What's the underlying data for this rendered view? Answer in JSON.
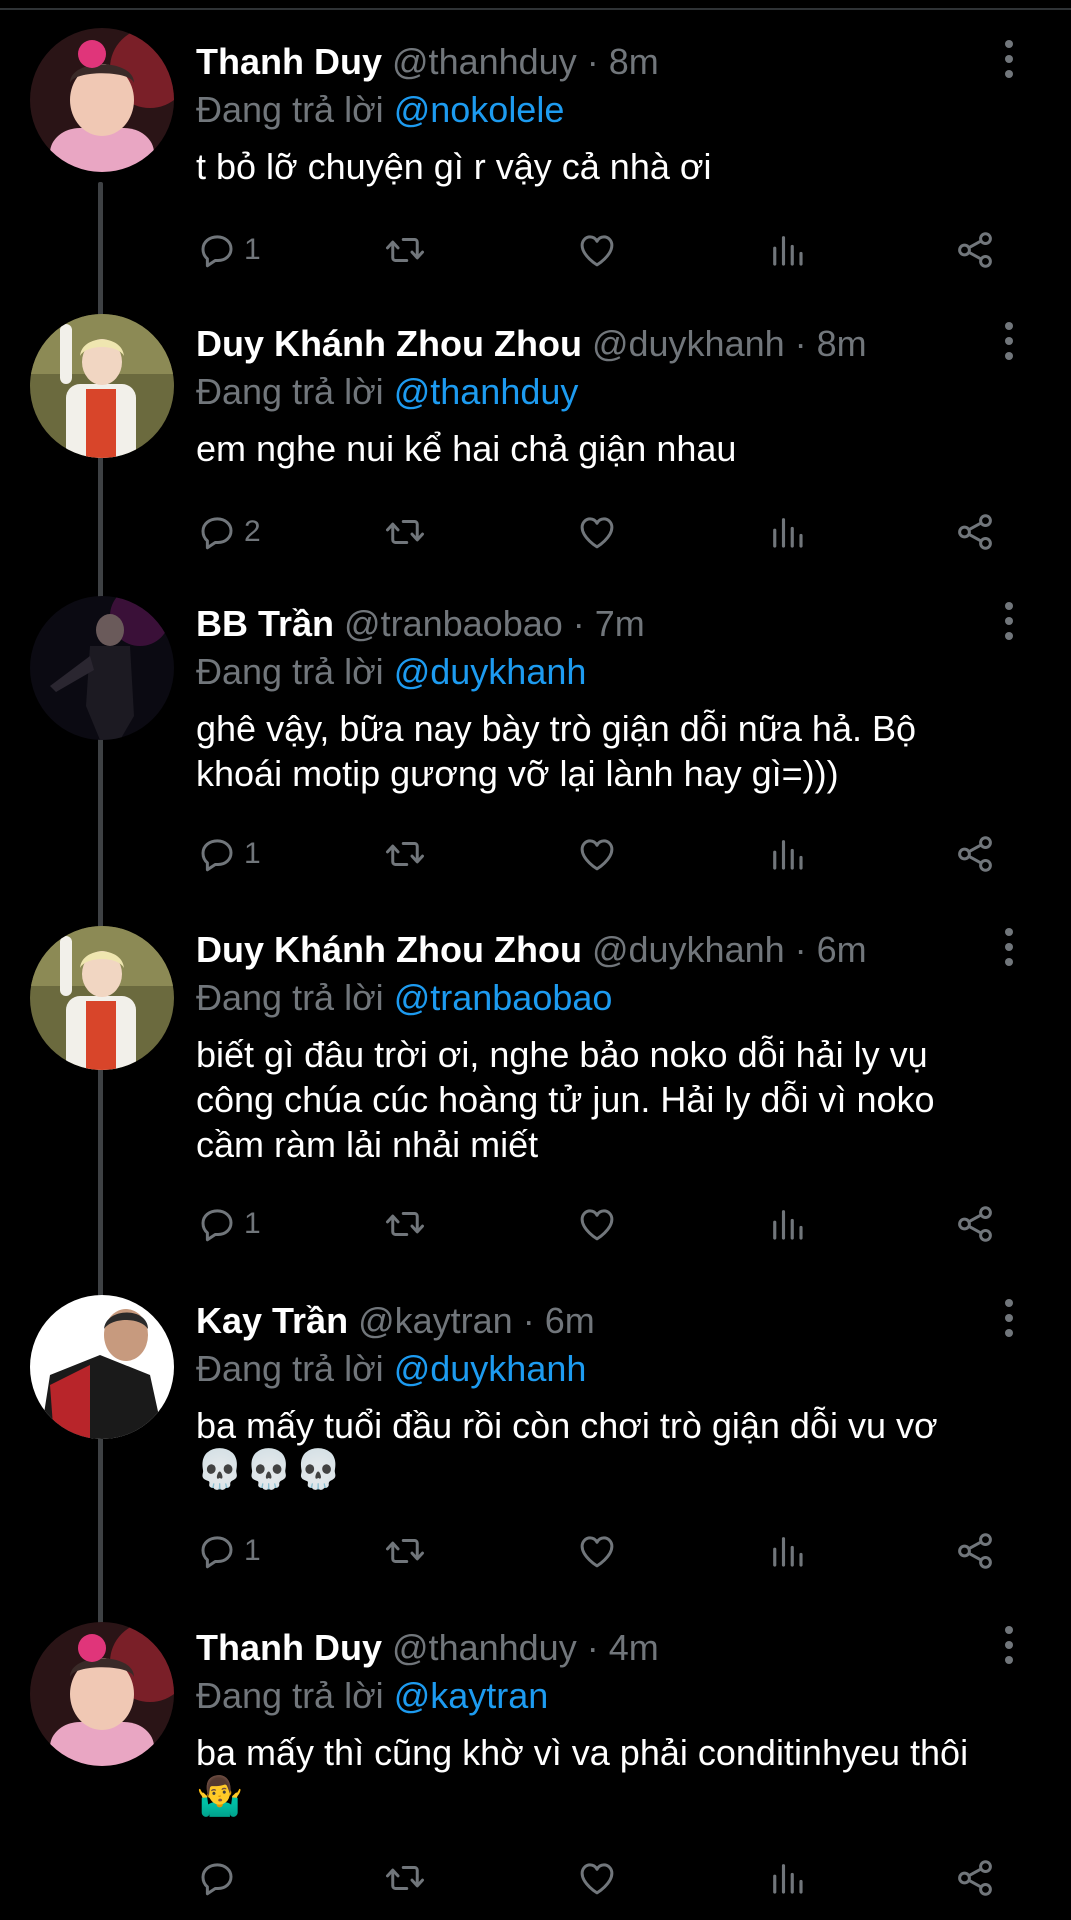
{
  "colors": {
    "background": "#000000",
    "name": "#ffffff",
    "muted": "#71767b",
    "mention": "#1d9bf0"
  },
  "replying_prefix": "Đang trả lời",
  "tweets": [
    {
      "name": "Thanh Duy",
      "handle": "@thanhduy",
      "time": "· 8m",
      "reply_to": "@nokolele",
      "text": "t bỏ lỡ chuyện gì r vậy cả nhà ơi",
      "emoji": "",
      "reply_count": "1",
      "avatar": "avatar-pink-hoodie"
    },
    {
      "name": "Duy Khánh Zhou Zhou",
      "handle": "@duykhanh",
      "time": "· 8m",
      "reply_to": "@thanhduy",
      "text": "em nghe nui kể hai chả giận nhau",
      "emoji": "",
      "reply_count": "2",
      "avatar": "avatar-blonde-white-coat"
    },
    {
      "name": "BB Trần",
      "handle": "@tranbaobao",
      "time": "· 7m",
      "reply_to": "@duykhanh",
      "text": "ghê vậy, bữa nay bày trò giận dỗi nữa hả. Bộ khoái motip gương vỡ lại lành hay gì=)))",
      "emoji": "",
      "reply_count": "1",
      "avatar": "avatar-dark-stage"
    },
    {
      "name": "Duy Khánh Zhou Zhou",
      "handle": "@duykhanh",
      "time": "· 6m",
      "reply_to": "@tranbaobao",
      "text": "biết gì đâu trời ơi, nghe bảo noko dỗi hải ly vụ công chúa cúc hoàng tử jun. Hải ly dỗi vì noko cầm ràm lải nhải miết",
      "emoji": "",
      "reply_count": "1",
      "avatar": "avatar-blonde-white-coat"
    },
    {
      "name": "Kay Trần",
      "handle": "@kaytran",
      "time": "· 6m",
      "reply_to": "@duykhanh",
      "text": "ba mấy tuổi đầu rồi còn chơi trò giận dỗi vu vơ",
      "emoji": "💀💀💀",
      "reply_count": "1",
      "avatar": "avatar-red-jacket"
    },
    {
      "name": "Thanh Duy",
      "handle": "@thanhduy",
      "time": "· 4m",
      "reply_to": "@kaytran",
      "text": "ba mấy thì cũng khờ vì va phải conditinhyeu thôi",
      "emoji": "🤷‍♂️",
      "reply_count": "",
      "avatar": "avatar-pink-hoodie"
    }
  ]
}
